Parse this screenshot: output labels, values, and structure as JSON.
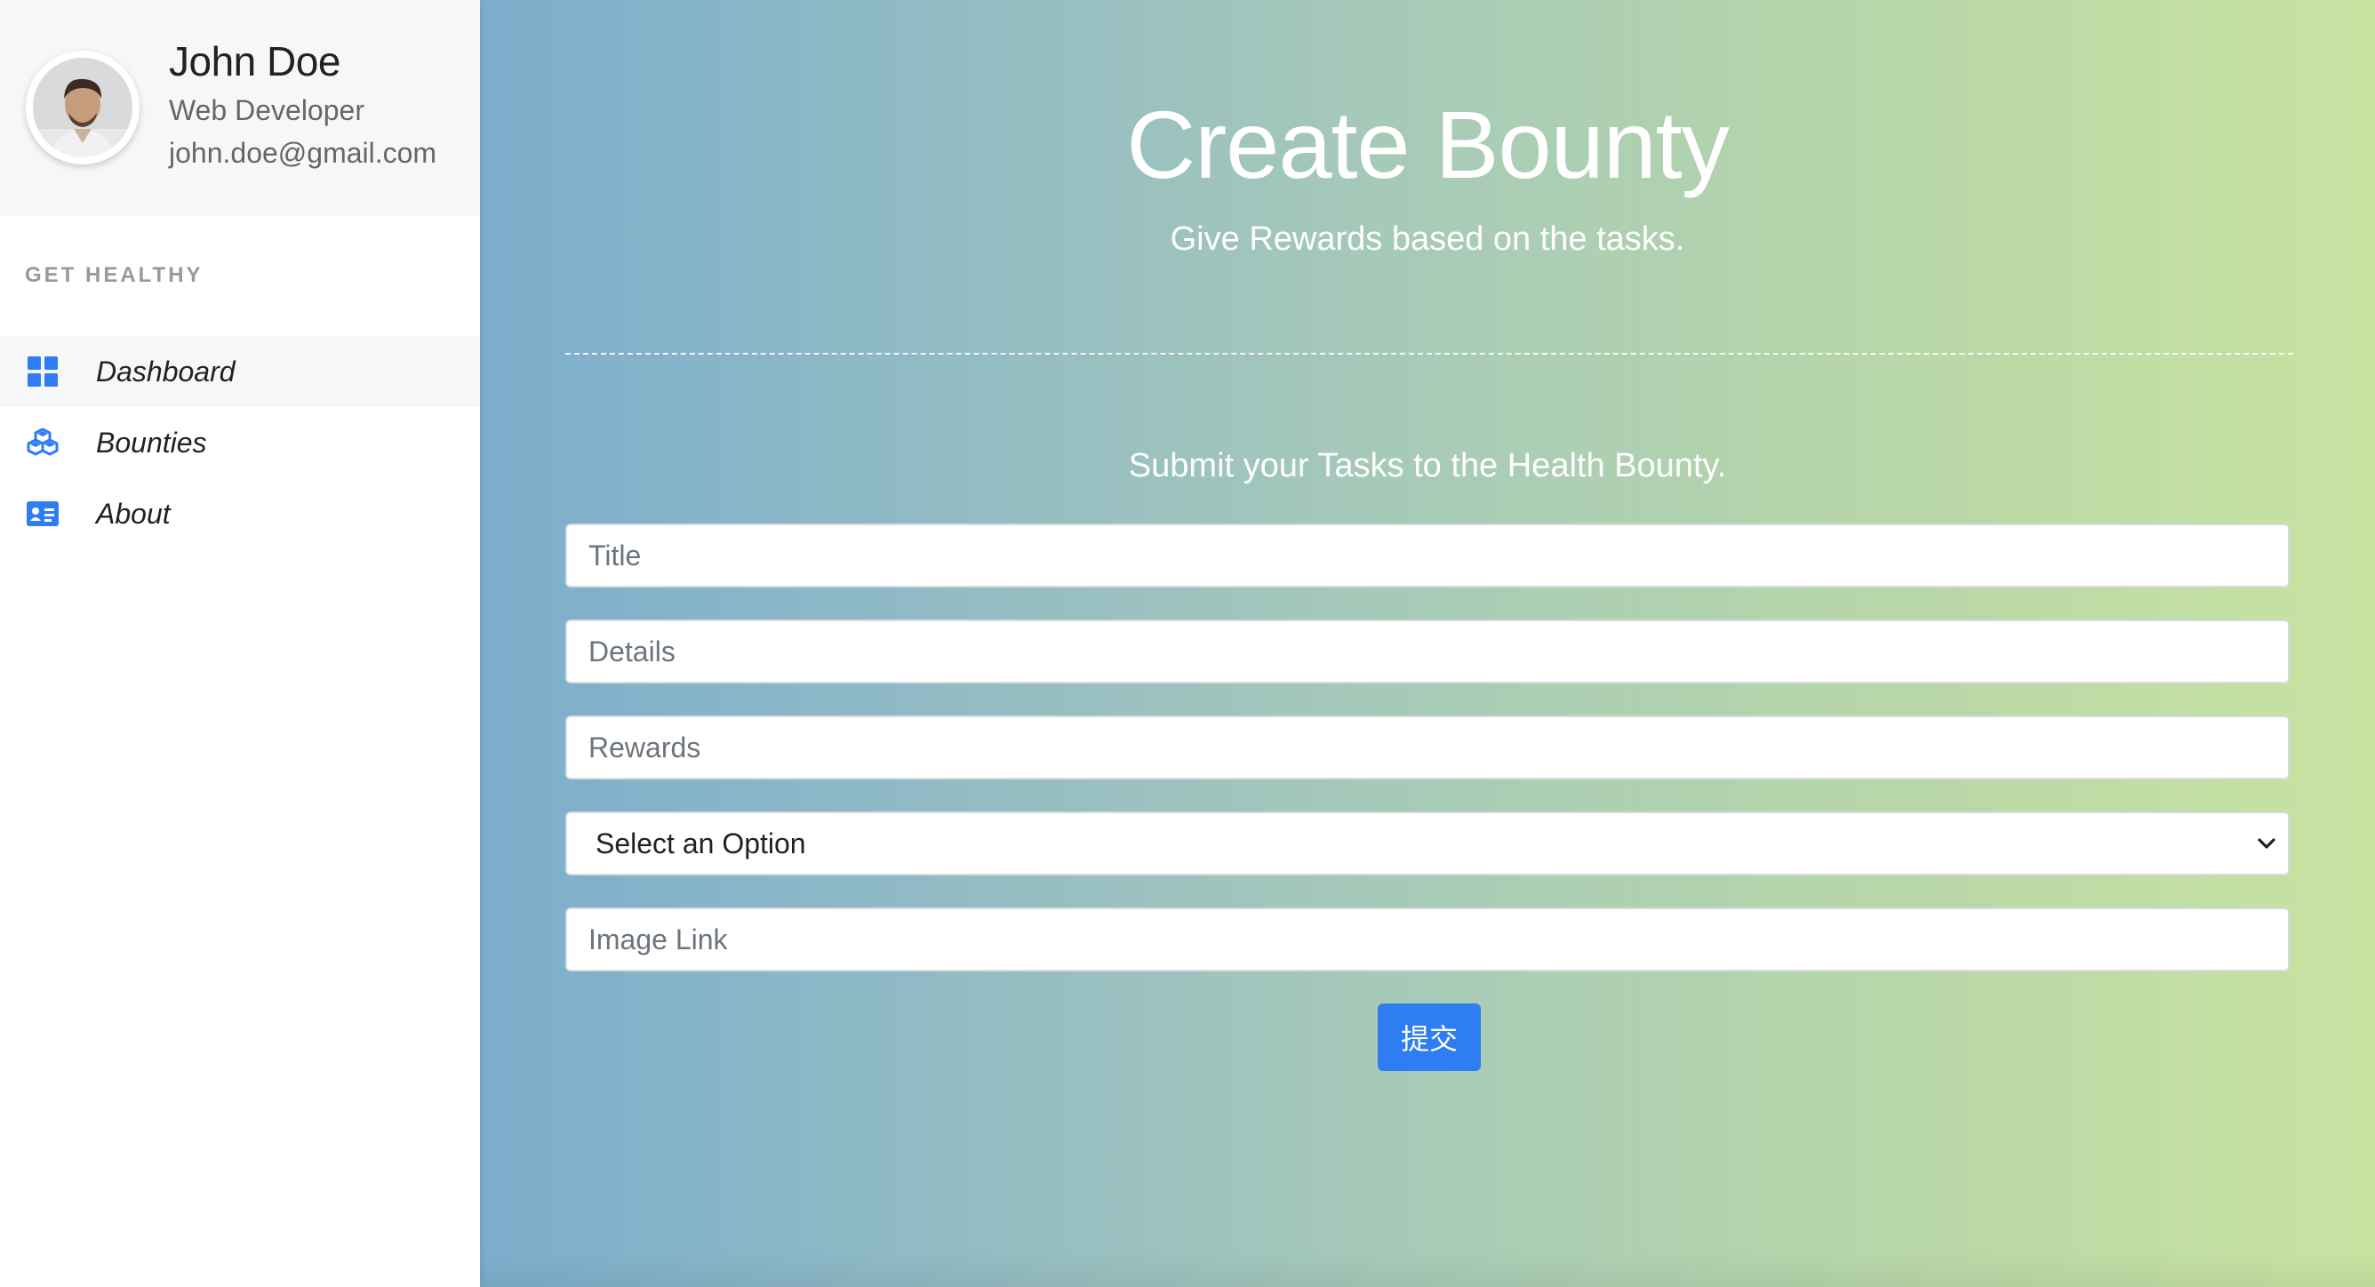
{
  "profile": {
    "name": "John Doe",
    "role": "Web Developer",
    "email": "john.doe@gmail.com",
    "avatar_icon": "person-photo"
  },
  "sidebar": {
    "section_heading": "GET HEALTHY",
    "items": [
      {
        "label": "Dashboard",
        "icon": "grid-icon",
        "active": true
      },
      {
        "label": "Bounties",
        "icon": "cubes-icon",
        "active": false
      },
      {
        "label": "About",
        "icon": "id-card-icon",
        "active": false
      }
    ]
  },
  "main": {
    "title": "Create Bounty",
    "subtitle": "Give Rewards based on the tasks.",
    "form_heading": "Submit your Tasks to the Health Bounty.",
    "fields": {
      "title_placeholder": "Title",
      "details_placeholder": "Details",
      "rewards_placeholder": "Rewards",
      "select_value": "Select an Option",
      "image_link_placeholder": "Image Link"
    },
    "submit_label": "提交"
  },
  "colors": {
    "accent": "#2f7df3",
    "icon_blue": "#2f7df3",
    "gradient_start": "#7caecc",
    "gradient_end": "#c8e3a1"
  }
}
